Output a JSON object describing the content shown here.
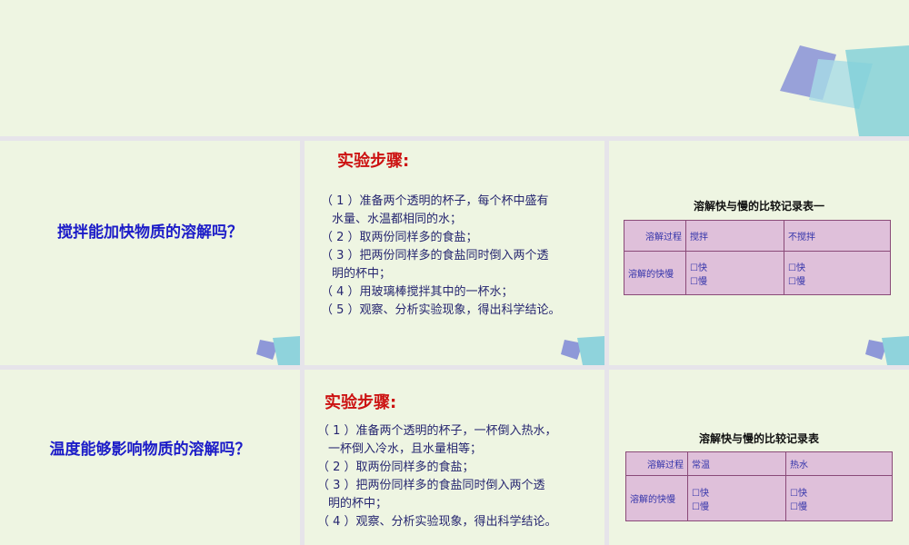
{
  "slide1": {
    "question": "搅拌能加快物质的溶解吗？",
    "steps_title": "实验步骤:",
    "steps": [
      "（ 1 ）准备两个透明的杯子，每个杯中盛有",
      "水量、水温都相同的水；",
      "（ 2 ）取两份同样多的食盐；",
      "（ 3 ）把两份同样多的食盐同时倒入两个透",
      "明的杯中；",
      "（ 4 ）用玻璃棒搅拌其中的一杯水；",
      "（ 5 ）观察、分析实验现象，得出科学结论。"
    ],
    "table": {
      "title": "溶解快与慢的比较记录表一",
      "row1": [
        "溶解过程",
        "搅拌",
        "不搅拌"
      ],
      "row2_label": "溶解的快慢",
      "fast": "☐快",
      "slow": "☐慢"
    }
  },
  "slide2": {
    "question": "温度能够影响物质的溶解吗？",
    "steps_title": "实验步骤:",
    "steps": [
      "（ 1 ）准备两个透明的杯子，一杯倒入热水，",
      "一杯倒入冷水，且水量相等；",
      "（ 2 ）取两份同样多的食盐；",
      "（ 3 ）把两份同样多的食盐同时倒入两个透",
      "明的杯中；",
      "（ 4 ）观察、分析实验现象，得出科学结论。"
    ],
    "table": {
      "title": "溶解快与慢的比较记录表",
      "row1": [
        "溶解过程",
        "常温",
        "热水"
      ],
      "row2_label": "溶解的快慢",
      "fast": "☐快",
      "slow": "☐慢"
    }
  }
}
